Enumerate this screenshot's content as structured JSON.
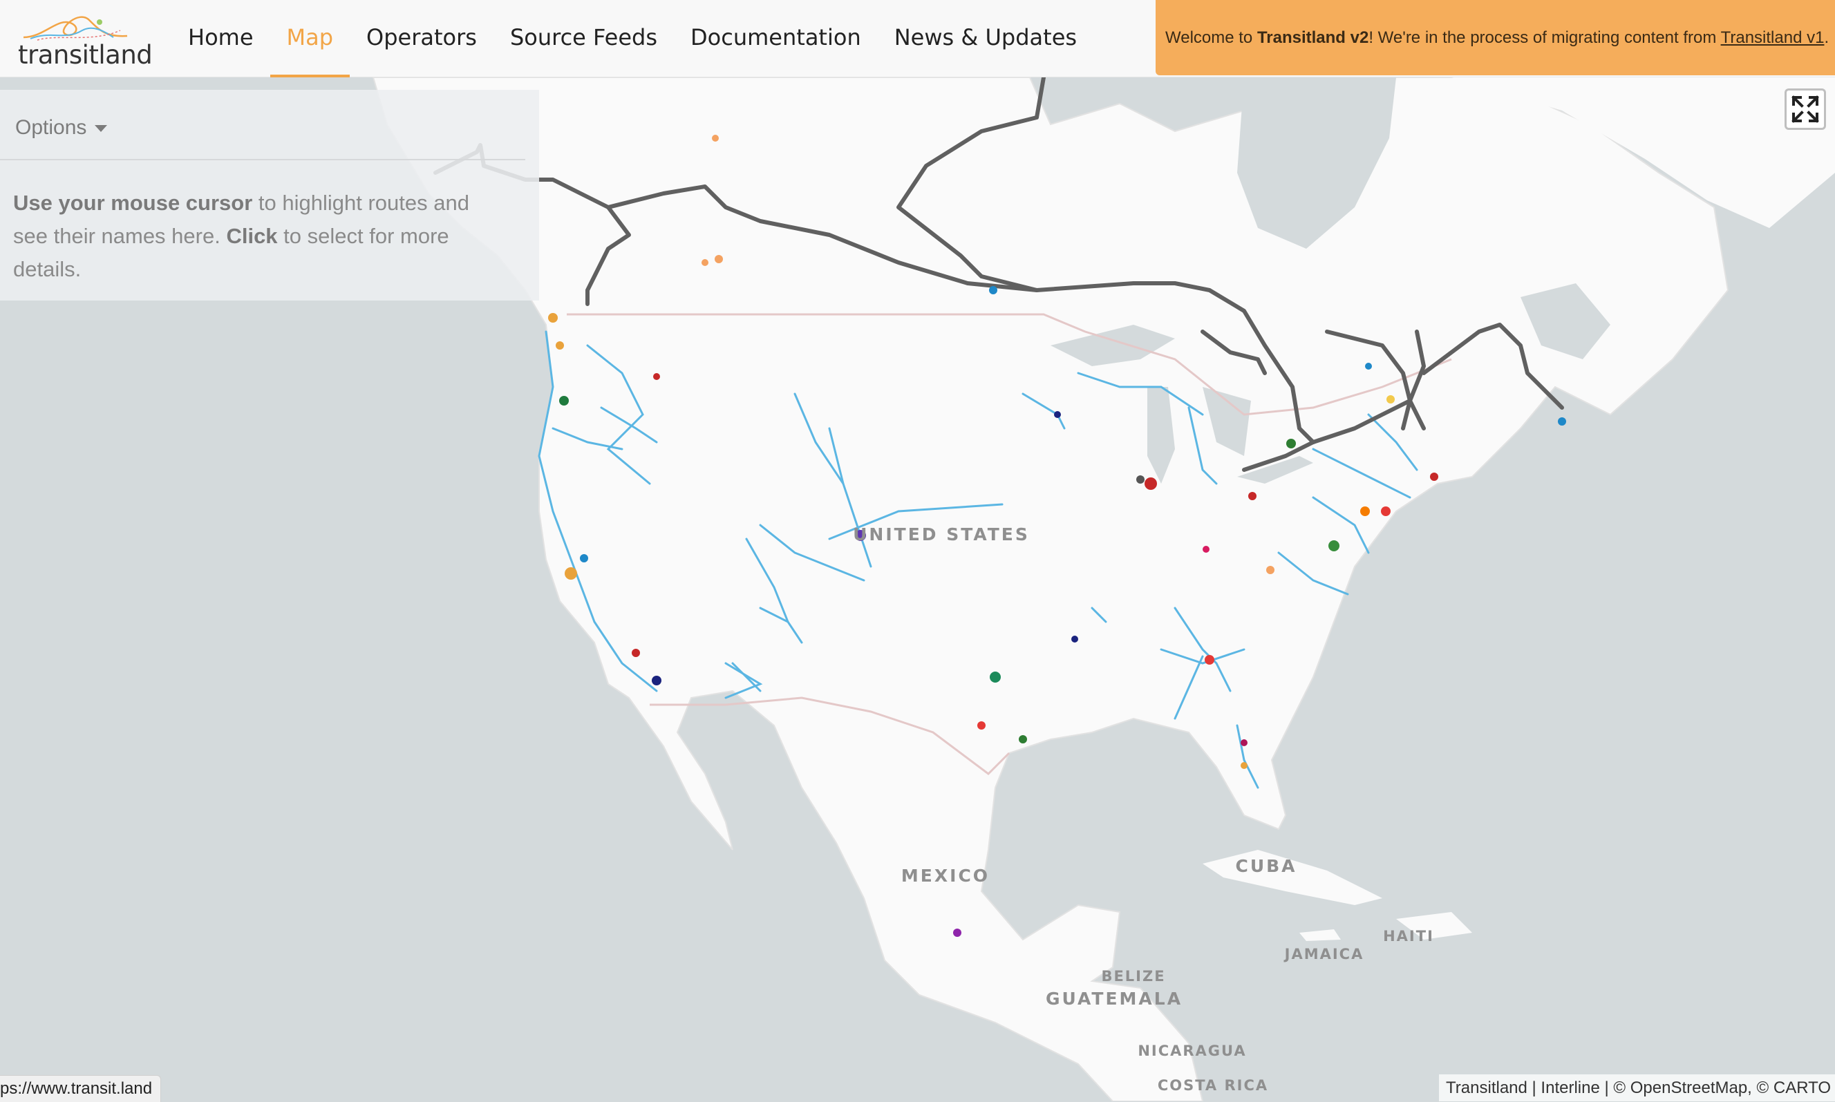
{
  "brand": {
    "logo_text": "transitland"
  },
  "nav": {
    "items": [
      {
        "label": "Home",
        "active": false
      },
      {
        "label": "Map",
        "active": true
      },
      {
        "label": "Operators",
        "active": false
      },
      {
        "label": "Source Feeds",
        "active": false
      },
      {
        "label": "Documentation",
        "active": false
      },
      {
        "label": "News & Updates",
        "active": false
      }
    ]
  },
  "banner": {
    "prefix": "Welcome to ",
    "product": "Transitland v2",
    "middle": "! We're in the process of migrating content from ",
    "link_text": "Transitland v1",
    "suffix": "."
  },
  "options": {
    "toggle_label": "Options",
    "hint_bold_1": "Use your mouse cursor",
    "hint_text_1": " to highlight routes and see their names here. ",
    "hint_bold_2": "Click",
    "hint_text_2": " to select for more details."
  },
  "map": {
    "labels": {
      "usa": "UNITED STATES",
      "mexico": "MEXICO",
      "cuba": "CUBA",
      "haiti": "HAITI",
      "jamaica": "JAMAICA",
      "belize": "BELIZE",
      "guatemala": "GUATEMALA",
      "nicaragua": "NICARAGUA",
      "costa_rica": "COSTA RICA"
    },
    "colors": {
      "water": "#d4dadc",
      "land": "#fafafa",
      "border": "#e4c8c8",
      "routes": "#5bb6e3",
      "rail": "#606060",
      "accent": "#f2a547"
    },
    "fullscreen_icon": "expand-arrows-icon"
  },
  "footer": {
    "status_url": "ps://www.transit.land",
    "attribution": "Transitland | Interline | © OpenStreetMap, © CARTO"
  }
}
